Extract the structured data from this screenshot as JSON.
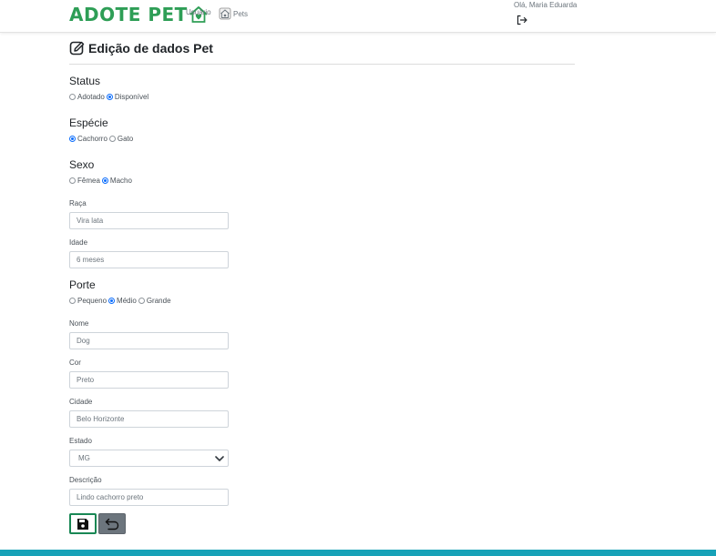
{
  "colors": {
    "brand": "#2e9e56",
    "primary": "#0d6efd",
    "success": "#198754",
    "secondary": "#6c757d",
    "footer": "#17a2b8"
  },
  "navbar": {
    "brand": "ADOTE PET",
    "brand_icon": "house-heart-icon",
    "links": [
      {
        "label": "Usuário"
      },
      {
        "label": "Pets",
        "icon": "pet-house-icon"
      }
    ],
    "greeting": "Olá, Maria Eduarda",
    "logout_icon": "logout-icon"
  },
  "page": {
    "title": "Edição de dados Pet",
    "title_icon": "edit-icon"
  },
  "form": {
    "status": {
      "label": "Status",
      "options": [
        {
          "label": "Adotado",
          "checked": false
        },
        {
          "label": "Disponível",
          "checked": true
        }
      ]
    },
    "especie": {
      "label": "Espécie",
      "options": [
        {
          "label": "Cachorro",
          "checked": true
        },
        {
          "label": "Gato",
          "checked": false
        }
      ]
    },
    "sexo": {
      "label": "Sexo",
      "options": [
        {
          "label": "Fêmea",
          "checked": false
        },
        {
          "label": "Macho",
          "checked": true
        }
      ]
    },
    "raca": {
      "label": "Raça",
      "value": "Vira lata"
    },
    "idade": {
      "label": "Idade",
      "value": "6 meses"
    },
    "porte": {
      "label": "Porte",
      "options": [
        {
          "label": "Pequeno",
          "checked": false
        },
        {
          "label": "Médio",
          "checked": true
        },
        {
          "label": "Grande",
          "checked": false
        }
      ]
    },
    "nome": {
      "label": "Nome",
      "value": "Dog"
    },
    "cor": {
      "label": "Cor",
      "value": "Preto"
    },
    "cidade": {
      "label": "Cidade",
      "value": "Belo Horizonte"
    },
    "estado": {
      "label": "Estado",
      "value": "MG"
    },
    "descricao": {
      "label": "Descrição",
      "value": "Lindo cachorro preto"
    }
  },
  "actions": {
    "save_icon": "save-icon",
    "back_icon": "back-arrow-icon"
  }
}
